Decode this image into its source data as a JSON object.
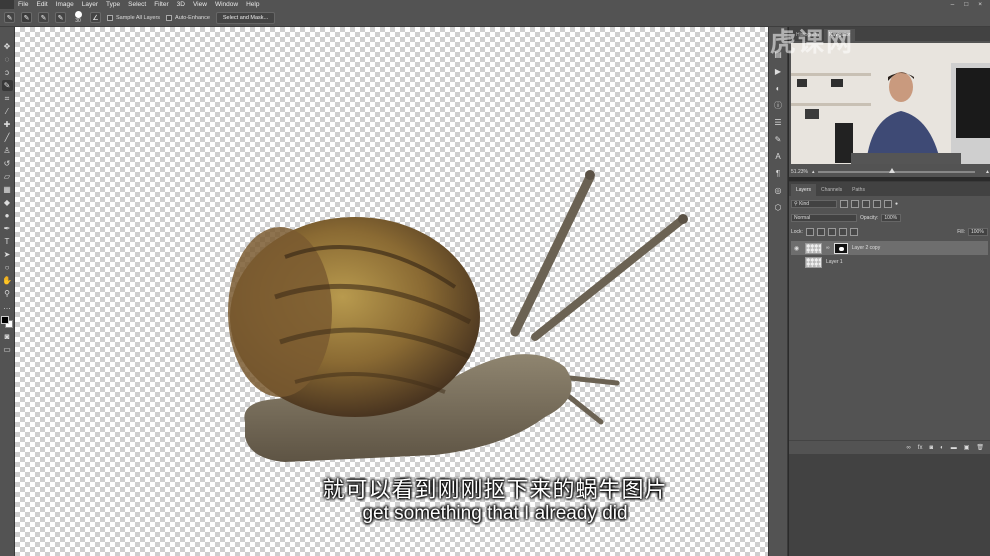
{
  "menubar": {
    "items": [
      "File",
      "Edit",
      "Image",
      "Layer",
      "Type",
      "Select",
      "Filter",
      "3D",
      "View",
      "Window",
      "Help"
    ]
  },
  "options": {
    "brush_size": "30",
    "sample_all_layers": "Sample All Layers",
    "auto_enhance": "Auto-Enhance",
    "select_and_mask": "Select and Mask..."
  },
  "navigator": {
    "tabs": [
      "Histogram",
      "Navigator"
    ],
    "zoom": "51.23%"
  },
  "layers": {
    "tabs": [
      "Layers",
      "Channels",
      "Paths"
    ],
    "filter_kind": "Kind",
    "blend_mode": "Normal",
    "opacity_label": "Opacity:",
    "opacity_value": "100%",
    "lock_label": "Lock:",
    "fill_label": "Fill:",
    "fill_value": "100%",
    "items": [
      {
        "name": "Layer 2 copy"
      },
      {
        "name": "Layer 1"
      }
    ]
  },
  "subtitles": {
    "cn": "就可以看到刚刚抠下来的蜗牛图片",
    "en": "get something that I already did"
  },
  "watermark": "虎课网",
  "colors": {
    "ui_bg": "#535353",
    "canvas_check": "#cfcfcf",
    "selected_layer": "#6e6e6e"
  }
}
